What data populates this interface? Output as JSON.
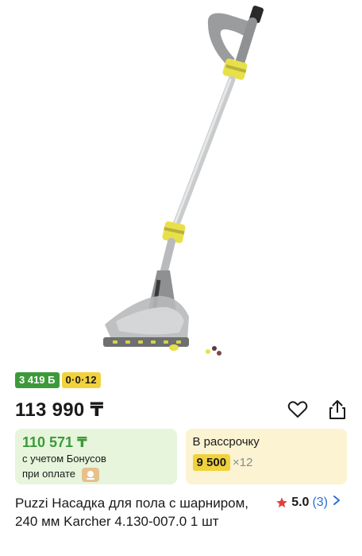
{
  "product": {
    "image_alt": "Puzzi floor nozzle with hinge",
    "title": "Puzzi Насадка для пола с шарниром, 240 мм Karcher 4.130-007.0 1 шт"
  },
  "badges": {
    "bonus": "3 419 Б",
    "installment": "0·0·12"
  },
  "price": {
    "main": "113 990 ₸"
  },
  "actions": {
    "favorite_icon": "heart-icon",
    "share_icon": "share-icon"
  },
  "bonus_card": {
    "price": "110 571 ₸",
    "line1": "с учетом Бонусов",
    "line2": "при оплате"
  },
  "installment_card": {
    "title": "В рассрочку",
    "amount": "9 500",
    "multiplier": "×12"
  },
  "rating": {
    "value": "5.0",
    "count": "(3)"
  },
  "colors": {
    "green": "#3d9a3a",
    "yellow": "#f2d23c",
    "link_blue": "#2b6fd6",
    "star_red": "#e0413a"
  }
}
